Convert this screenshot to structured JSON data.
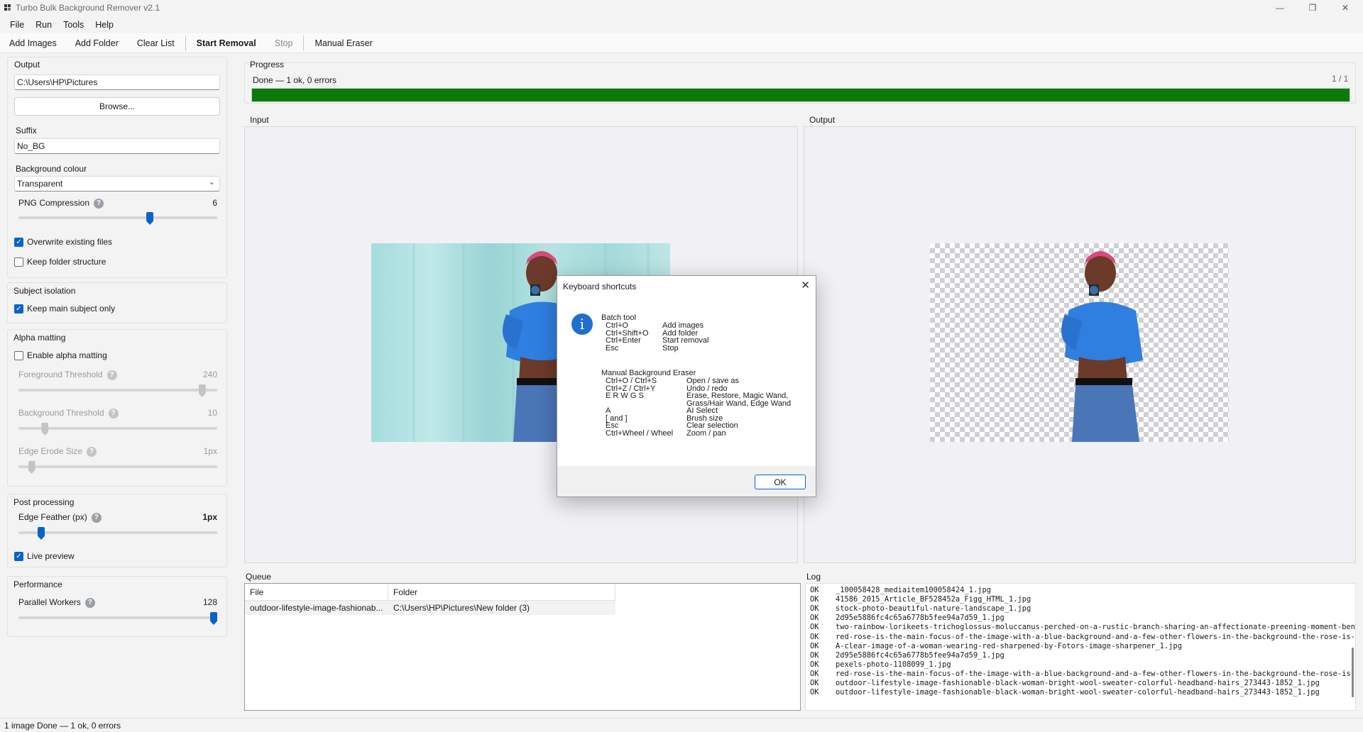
{
  "window": {
    "title": "Turbo Bulk Background Remover v2.1",
    "minimize": "—",
    "maximize": "❐",
    "close": "✕"
  },
  "menu": [
    "File",
    "Run",
    "Tools",
    "Help"
  ],
  "toolbar": {
    "add_images": "Add Images",
    "add_folder": "Add Folder",
    "clear_list": "Clear List",
    "start_removal": "Start Removal",
    "stop": "Stop",
    "manual_eraser": "Manual Eraser"
  },
  "output": {
    "label": "Output",
    "path": "C:\\Users\\HP\\Pictures",
    "browse": "Browse...",
    "suffix_label": "Suffix",
    "suffix": "No_BG",
    "bg_label": "Background colour",
    "bg_value": "Transparent",
    "png_label": "PNG Compression",
    "png_value": "6",
    "png_fraction": 0.667,
    "overwrite_label": "Overwrite existing files",
    "overwrite_checked": true,
    "keep_folder_label": "Keep folder structure",
    "keep_folder_checked": false
  },
  "subject": {
    "label": "Subject isolation",
    "keep_main_label": "Keep main subject only",
    "keep_main_checked": true
  },
  "alpha": {
    "label": "Alpha matting",
    "enable_label": "Enable alpha matting",
    "enable_checked": false,
    "fg_label": "Foreground Threshold",
    "fg_value": "240",
    "fg_fraction": 0.94,
    "bg_label": "Background Threshold",
    "bg_value": "10",
    "bg_fraction": 0.12,
    "erode_label": "Edge Erode Size",
    "erode_value": "1px",
    "erode_fraction": 0.05
  },
  "post": {
    "label": "Post processing",
    "feather_label": "Edge Feather (px)",
    "feather_value": "1px",
    "feather_fraction": 0.1,
    "live_label": "Live preview",
    "live_checked": true
  },
  "performance": {
    "label": "Performance",
    "workers_label": "Parallel Workers",
    "workers_value": "128",
    "workers_fraction": 1.0
  },
  "progress": {
    "label": "Progress",
    "status": "Done — 1 ok, 0 errors",
    "count": "1 / 1",
    "fraction": 1.0,
    "color": "#0b7a0b"
  },
  "preview": {
    "input_label": "Input",
    "output_label": "Output"
  },
  "queue": {
    "label": "Queue",
    "col_file": "File",
    "col_folder": "Folder",
    "rows": [
      {
        "file": "outdoor-lifestyle-image-fashionab...",
        "folder": "C:\\Users\\HP\\Pictures\\New folder (3)"
      }
    ]
  },
  "log": {
    "label": "Log",
    "lines": [
      {
        "status": "OK",
        "text": "_100058428_mediaitem100058424_1.jpg"
      },
      {
        "status": "OK",
        "text": "41586_2015_Article_BF528452a_Figg_HTML_1.jpg"
      },
      {
        "status": "OK",
        "text": "stock-photo-beautiful-nature-landscape_1.jpg"
      },
      {
        "status": "OK",
        "text": "2d95e5886fc4c65a6778b5fee94a7d59_1.jpg"
      },
      {
        "status": "OK",
        "text": "two-rainbow-lorikeets-trichoglossus-moluccanus-perched-on-a-rustic-branch-sharing-an-affectionate-preening-moment-benea"
      },
      {
        "status": "OK",
        "text": "red-rose-is-the-main-focus-of-the-image-with-a-blue-background-and-a-few-other-flowers-in-the-background-the-rose-is-th"
      },
      {
        "status": "OK",
        "text": "A-clear-image-of-a-woman-wearing-red-sharpened-by-Fotors-image-sharpener_1.jpg"
      },
      {
        "status": "OK",
        "text": "2d95e5886fc4c65a6778b5fee94a7d59_1.jpg"
      },
      {
        "status": "OK",
        "text": "pexels-photo-1108099_1.jpg"
      },
      {
        "status": "OK",
        "text": "red-rose-is-the-main-focus-of-the-image-with-a-blue-background-and-a-few-other-flowers-in-the-background-the-rose-is-th"
      },
      {
        "status": "OK",
        "text": "outdoor-lifestyle-image-fashionable-black-woman-bright-wool-sweater-colorful-headband-hairs_273443-1852_1.jpg"
      },
      {
        "status": "OK",
        "text": "outdoor-lifestyle-image-fashionable-black-woman-bright-wool-sweater-colorful-headband-hairs_273443-1852_1.jpg"
      }
    ]
  },
  "statusbar": {
    "count": "1 image",
    "status": "Done — 1 ok, 0 errors"
  },
  "dialog": {
    "title": "Keyboard shortcuts",
    "close": "✕",
    "icon": "i",
    "ok": "OK",
    "batch_title": "Batch tool",
    "batch": [
      {
        "key": "Ctrl+O",
        "desc": "Add images"
      },
      {
        "key": "Ctrl+Shift+O",
        "desc": "Add folder"
      },
      {
        "key": "Ctrl+Enter",
        "desc": "Start removal"
      },
      {
        "key": "Esc",
        "desc": "Stop"
      }
    ],
    "manual_title": "Manual Background Eraser",
    "manual": [
      {
        "key": "Ctrl+O / Ctrl+S",
        "desc": "Open / save as"
      },
      {
        "key": "Ctrl+Z / Ctrl+Y",
        "desc": "Undo / redo"
      },
      {
        "key": "E R W G S",
        "desc": "Erase, Restore, Magic Wand,"
      },
      {
        "key": "",
        "desc": "Grass/Hair Wand, Edge Wand"
      },
      {
        "key": "A",
        "desc": "AI Select"
      },
      {
        "key": "[ and ]",
        "desc": "Brush size"
      },
      {
        "key": "Esc",
        "desc": "Clear selection"
      },
      {
        "key": "Ctrl+Wheel / Wheel",
        "desc": "Zoom / pan"
      }
    ]
  },
  "colors": {
    "accent": "#0a63c9",
    "progress": "#0b7a0b",
    "teal_bg": "#a8dedd",
    "sweater": "#2f7fe0"
  }
}
